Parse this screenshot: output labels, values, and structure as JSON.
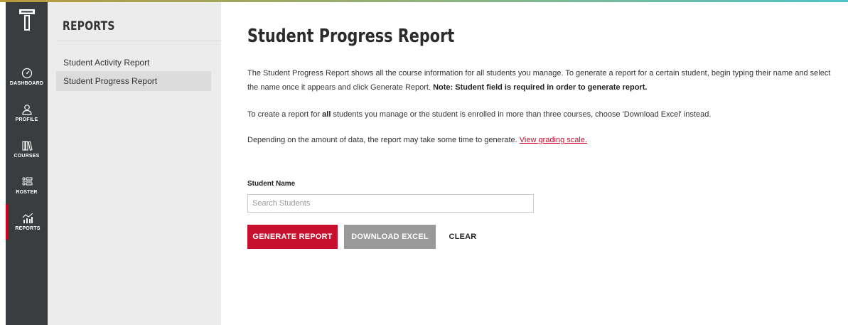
{
  "sidebar": {
    "items": [
      {
        "label": "DASHBOARD",
        "icon": "dashboard-icon"
      },
      {
        "label": "PROFILE",
        "icon": "profile-icon"
      },
      {
        "label": "COURSES",
        "icon": "courses-icon"
      },
      {
        "label": "ROSTER",
        "icon": "roster-icon"
      },
      {
        "label": "REPORTS",
        "icon": "reports-icon",
        "active": true
      }
    ]
  },
  "subnav": {
    "title": "REPORTS",
    "items": [
      {
        "label": "Student Activity Report"
      },
      {
        "label": "Student Progress Report",
        "selected": true
      }
    ]
  },
  "main": {
    "title": "Student Progress Report",
    "p1": {
      "text": "The Student Progress Report shows all the course information for all students you manage. To generate a report for a certain student, begin typing their name and select the name once it appears and click Generate Report.",
      "note": "Note: Student field is required in order to generate report."
    },
    "p2": {
      "pre": "To create a report for",
      "bold": "all",
      "post": "students you manage or the student is enrolled in more than three courses, choose 'Download Excel' instead."
    },
    "p3": {
      "text": "Depending on the amount of data, the report may take some time to generate.",
      "link": "View grading scale."
    },
    "field_label": "Student Name",
    "search": {
      "placeholder": "Search Students",
      "value": ""
    },
    "buttons": {
      "generate": "GENERATE REPORT",
      "download": "DOWNLOAD EXCEL",
      "clear": "CLEAR"
    }
  },
  "colors": {
    "accent": "#c8102e",
    "sidebar_bg": "#3a3d3f",
    "subnav_bg": "#ececec",
    "button_gray": "#999999"
  }
}
